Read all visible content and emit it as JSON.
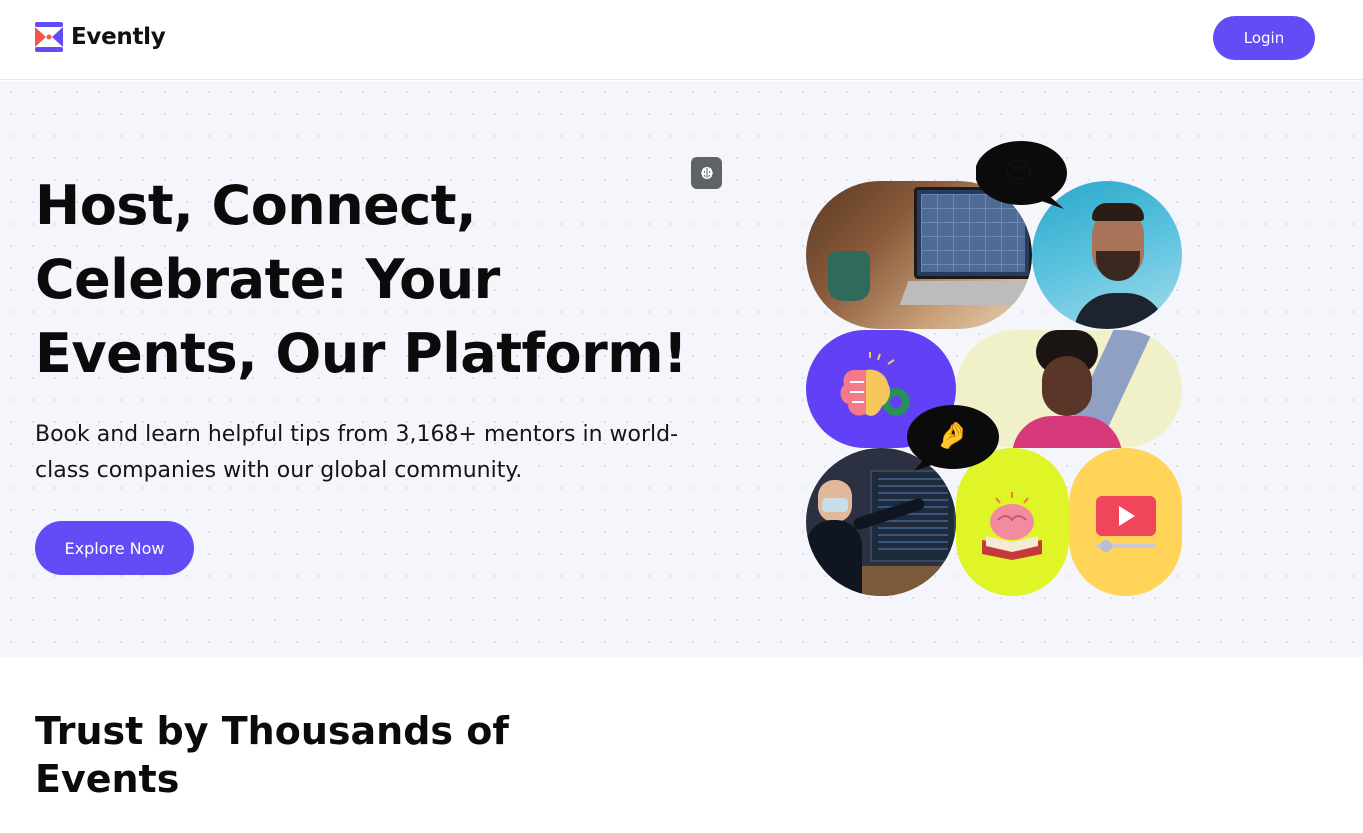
{
  "brand": {
    "name": "Evently",
    "accent": "#624cf5",
    "logo_colors": [
      "#624cf5",
      "#f0564a"
    ]
  },
  "header": {
    "login_label": "Login"
  },
  "hero": {
    "title": "Host, Connect, Celebrate: Your Events, Our Platform!",
    "subtitle": "Book and learn helpful tips from 3,168+ mentors in world-class companies with our global community.",
    "cta_label": "Explore Now",
    "chip_icon": "brain-icon",
    "collage": {
      "bubble_emojis": [
        "😍",
        "🤌"
      ],
      "tiles": [
        "laptop-video-call-photo",
        "laughing-man-photo",
        "brain-gear-illustration",
        "smiling-woman-photo",
        "presenter-photo",
        "brain-book-illustration",
        "video-player-illustration"
      ]
    }
  },
  "trust": {
    "title": "Trust by Thousands of Events"
  }
}
